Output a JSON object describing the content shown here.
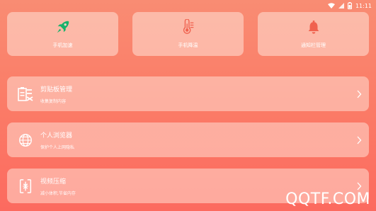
{
  "status_bar": {
    "time": "11:11",
    "icons": [
      "wifi-icon",
      "signal-icon",
      "battery-icon"
    ]
  },
  "tiles": [
    {
      "label": "手机加速",
      "icon": "rocket-icon",
      "color": "#19b26b"
    },
    {
      "label": "手机降温",
      "icon": "thermometer-icon",
      "color": "#f0624f"
    },
    {
      "label": "通知栏管理",
      "icon": "bell-icon",
      "color": "#f0624f"
    }
  ],
  "rows": [
    {
      "title": "剪贴板管理",
      "subtitle": "收集复制内容",
      "icon": "clipboard-icon"
    },
    {
      "title": "个人浏览器",
      "subtitle": "保护个人上网隐私",
      "icon": "globe-icon"
    },
    {
      "title": "视频压缩",
      "subtitle": "减小体积,节省内存",
      "icon": "compress-icon"
    }
  ],
  "watermark": "QQTF.COM"
}
